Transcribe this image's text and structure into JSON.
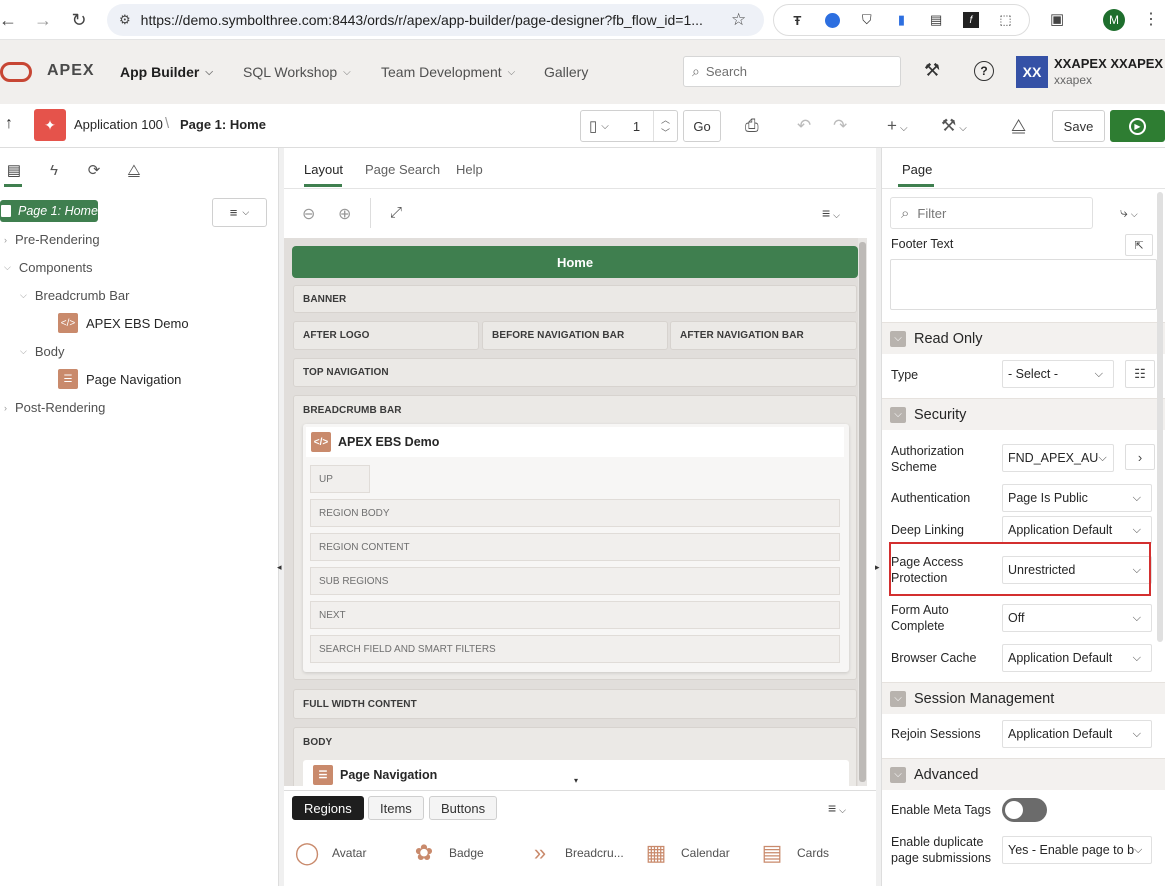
{
  "browser": {
    "url": "https://demo.symbolthree.com:8443/ords/r/apex/app-builder/page-designer?fb_flow_id=1...",
    "profile_initial": "M"
  },
  "header": {
    "logo_text": "APEX",
    "menus": [
      "App Builder",
      "SQL Workshop",
      "Team Development",
      "Gallery"
    ],
    "search_placeholder": "Search",
    "user_initials": "XX",
    "user_name": "XXAPEX XXAPEX",
    "user_login": "xxapex"
  },
  "toolbar": {
    "app_label": "Application 100",
    "page_label": "Page 1: Home",
    "page_number": "1",
    "go_label": "Go",
    "save_label": "Save"
  },
  "left": {
    "root": "Page 1: Home",
    "tree": {
      "pre_rendering": "Pre-Rendering",
      "components": "Components",
      "breadcrumb_bar": "Breadcrumb Bar",
      "apex_ebs_demo": "APEX EBS Demo",
      "body": "Body",
      "page_navigation": "Page Navigation",
      "post_rendering": "Post-Rendering"
    }
  },
  "center": {
    "tabs": [
      "Layout",
      "Page Search",
      "Help"
    ],
    "page_title": "Home",
    "banner": "BANNER",
    "after_logo": "AFTER LOGO",
    "before_nav": "BEFORE NAVIGATION BAR",
    "after_nav": "AFTER NAVIGATION BAR",
    "top_nav": "TOP NAVIGATION",
    "breadcrumb_bar": "BREADCRUMB BAR",
    "region_title": "APEX EBS Demo",
    "subs": [
      "UP",
      "REGION BODY",
      "REGION CONTENT",
      "SUB REGIONS",
      "NEXT",
      "SEARCH FIELD AND SMART FILTERS"
    ],
    "full_width": "FULL WIDTH CONTENT",
    "body": "BODY",
    "body_region": "Page Navigation"
  },
  "gallery": {
    "tabs": [
      "Regions",
      "Items",
      "Buttons"
    ],
    "items": [
      "Avatar",
      "Badge",
      "Breadcru...",
      "Calendar",
      "Cards"
    ]
  },
  "right": {
    "tab": "Page",
    "filter_placeholder": "Filter",
    "footer_text_label": "Footer Text",
    "read_only": "Read Only",
    "type_label": "Type",
    "type_value": "- Select -",
    "security": "Security",
    "auth_scheme_label": "Authorization Scheme",
    "auth_scheme_value": "FND_APEX_AU",
    "authentication_label": "Authentication",
    "authentication_value": "Page Is Public",
    "deep_linking_label": "Deep Linking",
    "deep_linking_value": "Application Default",
    "page_access_label": "Page Access Protection",
    "page_access_value": "Unrestricted",
    "form_auto_label": "Form Auto Complete",
    "form_auto_value": "Off",
    "browser_cache_label": "Browser Cache",
    "browser_cache_value": "Application Default",
    "session_mgmt": "Session Management",
    "rejoin_label": "Rejoin Sessions",
    "rejoin_value": "Application Default",
    "advanced": "Advanced",
    "meta_tags_label": "Enable Meta Tags",
    "meta_tags_on": false,
    "dup_label": "Enable duplicate page submissions",
    "dup_value": "Yes - Enable page to b"
  },
  "colors": {
    "apex_red": "#c74634",
    "canvas_bg": "#e1dedb",
    "title_bar": "#3f7f4f",
    "run_button": "#2e7d32",
    "highlight_box": "#d32f2f",
    "user_avatar": "#3551a6"
  }
}
